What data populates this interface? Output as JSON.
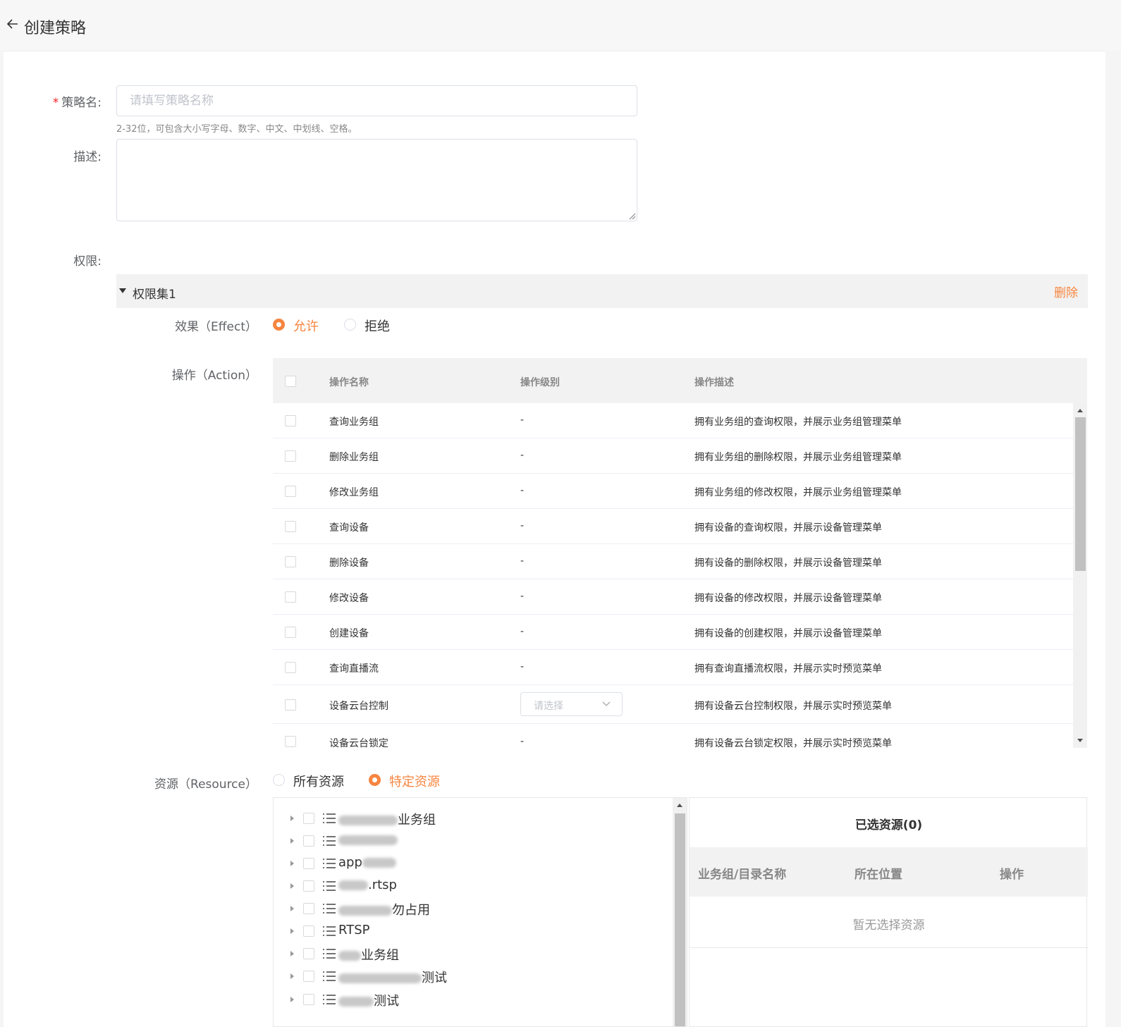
{
  "header": {
    "title": "创建策略"
  },
  "form": {
    "name_label": "策略名:",
    "required_mark": "*",
    "name_placeholder": "请填写策略名称",
    "name_hint": "2-32位，可包含大小写字母、数字、中文、中划线、空格。",
    "desc_label": "描述:",
    "perm_label": "权限:"
  },
  "permission_set": {
    "title": "权限集1",
    "delete_label": "删除",
    "effect_label": "效果（Effect）",
    "effect_options": [
      "允许",
      "拒绝"
    ],
    "effect_selected": "允许",
    "action_label": "操作（Action）",
    "action_columns": [
      "操作名称",
      "操作级别",
      "操作描述"
    ],
    "actions": [
      {
        "name": "查询业务组",
        "level": "-",
        "desc": "拥有业务组的查询权限，并展示业务组管理菜单"
      },
      {
        "name": "删除业务组",
        "level": "-",
        "desc": "拥有业务组的删除权限，并展示业务组管理菜单"
      },
      {
        "name": "修改业务组",
        "level": "-",
        "desc": "拥有业务组的修改权限，并展示业务组管理菜单"
      },
      {
        "name": "查询设备",
        "level": "-",
        "desc": "拥有设备的查询权限，并展示设备管理菜单"
      },
      {
        "name": "删除设备",
        "level": "-",
        "desc": "拥有设备的删除权限，并展示设备管理菜单"
      },
      {
        "name": "修改设备",
        "level": "-",
        "desc": "拥有设备的修改权限，并展示设备管理菜单"
      },
      {
        "name": "创建设备",
        "level": "-",
        "desc": "拥有设备的创建权限，并展示设备管理菜单"
      },
      {
        "name": "查询直播流",
        "level": "-",
        "desc": "拥有查询直播流权限，并展示实时预览菜单"
      },
      {
        "name": "设备云台控制",
        "level": "",
        "level_placeholder": "请选择",
        "desc": "拥有设备云台控制权限，并展示实时预览菜单"
      },
      {
        "name": "设备云台锁定",
        "level": "-",
        "desc": "拥有设备云台锁定权限，并展示实时预览菜单"
      }
    ],
    "resource_label": "资源（Resource）",
    "resource_options": [
      "所有资源",
      "特定资源"
    ],
    "resource_selected": "特定资源",
    "resource_tree": [
      {
        "suffix": "业务组",
        "prefix": ""
      },
      {
        "suffix": "",
        "prefix": ""
      },
      {
        "suffix": "",
        "prefix": "app"
      },
      {
        "suffix": ".rtsp",
        "prefix": ""
      },
      {
        "suffix": "勿占用",
        "prefix": ""
      },
      {
        "suffix": "",
        "prefix": "RTSP"
      },
      {
        "suffix": "业务组",
        "prefix": ""
      },
      {
        "suffix": "测试",
        "prefix": ""
      },
      {
        "suffix": "测试",
        "prefix": ""
      }
    ],
    "selected_title": "已选资源(0)",
    "selected_columns": [
      "业务组/目录名称",
      "所在位置",
      "操作"
    ],
    "selected_empty": "暂无选择资源"
  },
  "colors": {
    "accent": "#f6853f",
    "required": "#f5222d"
  }
}
